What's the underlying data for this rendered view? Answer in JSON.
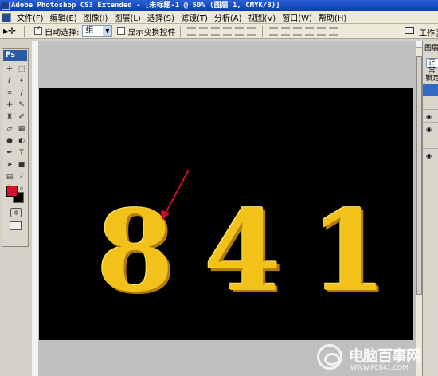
{
  "window": {
    "title": "Adobe Photoshop CS3 Extended - [未标题-1 @ 50% (图层 1, CMYK/8)]"
  },
  "menu": [
    "文件(F)",
    "编辑(E)",
    "图像(I)",
    "图层(L)",
    "选择(S)",
    "滤镜(T)",
    "分析(A)",
    "视图(V)",
    "窗口(W)",
    "帮助(H)"
  ],
  "options": {
    "auto_select_label": "自动选择:",
    "auto_select_checked": true,
    "auto_select_target": "组",
    "show_transform_label": "显示变换控件",
    "show_transform_checked": false,
    "workspace_label": "工作区"
  },
  "toolbox": {
    "logo": "Ps",
    "tools": [
      "move-tool",
      "rect-marquee-tool",
      "lasso-tool",
      "magic-wand-tool",
      "crop-tool",
      "slice-tool",
      "healing-tool",
      "brush-tool",
      "clone-stamp-tool",
      "history-brush-tool",
      "eraser-tool",
      "gradient-tool",
      "blur-tool",
      "dodge-tool",
      "pen-tool",
      "type-tool",
      "path-select-tool",
      "shape-tool",
      "notes-tool",
      "eyedropper-tool",
      "hand-tool",
      "zoom-tool"
    ],
    "fg_color": "#d9102a",
    "bg_color": "#000000"
  },
  "canvas": {
    "zoom": "50%",
    "background": "#000000",
    "digits": [
      "8",
      "4",
      "1"
    ],
    "digit_color": "#f2c21b",
    "annotation_arrow_color": "#c8102e"
  },
  "layers_panel": {
    "tab": "图层",
    "blend_mode": "正常",
    "lock_label": "锁定"
  },
  "watermark": {
    "name": "电脑百事网",
    "url": "WWW.PC841.COM"
  }
}
